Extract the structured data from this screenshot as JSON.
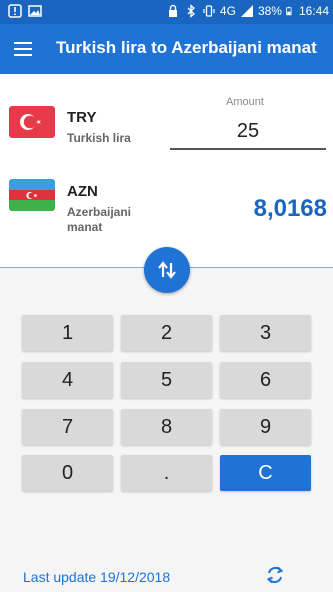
{
  "statusbar": {
    "network": "4G",
    "battery": "38%",
    "time": "16:44",
    "icons": [
      "alert-icon",
      "image-icon",
      "lock-icon",
      "bluetooth-icon",
      "vibrate-icon",
      "signal-icon",
      "battery-icon"
    ]
  },
  "appbar": {
    "title": "Turkish lira to Azerbaijani manat",
    "menu_icon": "menu-icon"
  },
  "from": {
    "code": "TRY",
    "name": "Turkish lira",
    "amount_label": "Amount",
    "amount_value": "25",
    "flag_colors": [
      "#e8394a",
      "#ffffff"
    ]
  },
  "to": {
    "code": "AZN",
    "name_line1": "Azerbaijani",
    "name_line2": "manat",
    "result": "8,0168",
    "flag_colors": [
      "#3aa0d8",
      "#e0323c",
      "#3db24a"
    ]
  },
  "keypad": {
    "keys": [
      "1",
      "2",
      "3",
      "4",
      "5",
      "6",
      "7",
      "8",
      "9",
      "0",
      ".",
      "C"
    ]
  },
  "footer": {
    "last_update": "Last update 19/12/2018"
  },
  "colors": {
    "primary": "#1e73d4",
    "statusbar": "#1a65c0",
    "key_bg": "#d9d9d9"
  }
}
